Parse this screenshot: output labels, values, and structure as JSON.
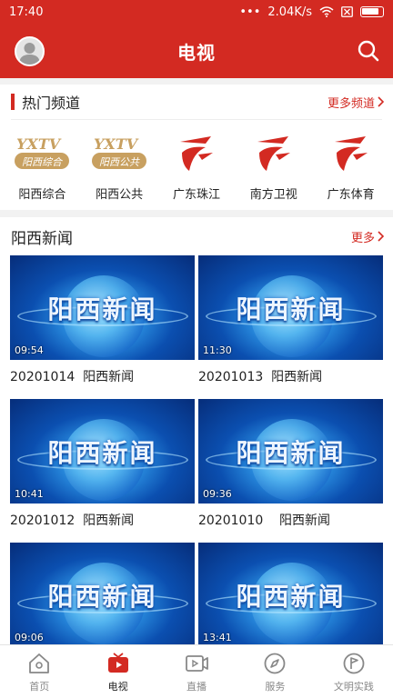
{
  "status": {
    "time": "17:40",
    "speed": "2.04K/s",
    "dots": "•••"
  },
  "header": {
    "title": "电视"
  },
  "channels": {
    "title": "热门频道",
    "more": "更多频道",
    "items": [
      {
        "name": "阳西综合",
        "logo_text": "YXTV",
        "logo_sub": "阳西综合"
      },
      {
        "name": "阳西公共",
        "logo_text": "YXTV",
        "logo_sub": "阳西公共"
      },
      {
        "name": "广东珠江"
      },
      {
        "name": "南方卫视"
      },
      {
        "name": "广东体育"
      }
    ]
  },
  "news": {
    "title": "阳西新闻",
    "more": "更多",
    "thumb_text": "阳西新闻",
    "items": [
      {
        "duration": "09:54",
        "caption": "20201014  阳西新闻"
      },
      {
        "duration": "11:30",
        "caption": "20201013  阳西新闻"
      },
      {
        "duration": "10:41",
        "caption": "20201012  阳西新闻"
      },
      {
        "duration": "09:36",
        "caption": "20201010    阳西新闻"
      },
      {
        "duration": "09:06",
        "caption": ""
      },
      {
        "duration": "13:41",
        "caption": ""
      }
    ]
  },
  "tabs": [
    {
      "label": "首页",
      "icon": "home-icon"
    },
    {
      "label": "电视",
      "icon": "tv-icon",
      "active": true
    },
    {
      "label": "直播",
      "icon": "live-icon"
    },
    {
      "label": "服务",
      "icon": "compass-icon"
    },
    {
      "label": "文明实践",
      "icon": "flag-icon"
    }
  ],
  "colors": {
    "brand": "#d32a22",
    "tab_inactive": "#888888"
  }
}
